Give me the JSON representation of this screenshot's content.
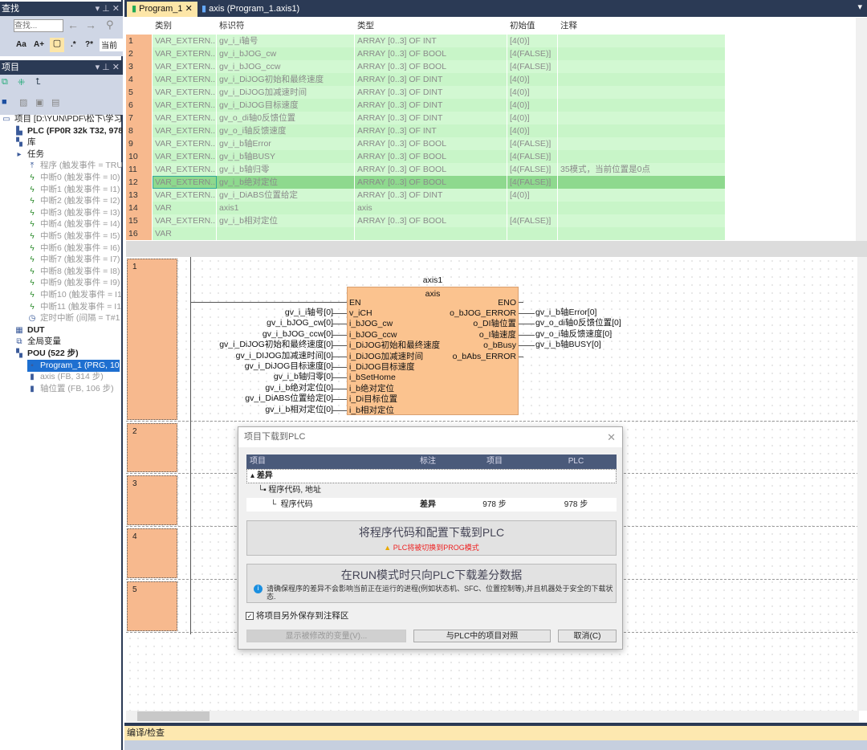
{
  "find_panel": {
    "title": "查找",
    "search_placeholder": "查找...",
    "scope": "当前"
  },
  "project_panel": {
    "title": "项目"
  },
  "tree": [
    {
      "label": "项目 [D:\\YUN\\PDF\\松下\\学习",
      "icon": "project-icon",
      "indent": 0,
      "gray": false,
      "bold": false
    },
    {
      "label": "PLC (FP0R 32k T32, 978",
      "icon": "plc-icon",
      "indent": 1,
      "gray": false,
      "bold": true
    },
    {
      "label": "库",
      "icon": "library-icon",
      "indent": 1,
      "gray": false,
      "bold": false
    },
    {
      "label": "任务",
      "icon": "folder-icon",
      "indent": 1,
      "gray": false,
      "bold": false
    },
    {
      "label": "程序 (触发事件 = TRU",
      "icon": "program-task-icon",
      "indent": 2,
      "gray": true
    },
    {
      "label": "中断0 (触发事件 = I0)",
      "icon": "interrupt-icon",
      "indent": 2,
      "gray": true
    },
    {
      "label": "中断1 (触发事件 = I1)",
      "icon": "interrupt-icon",
      "indent": 2,
      "gray": true
    },
    {
      "label": "中断2 (触发事件 = I2)",
      "icon": "interrupt-icon",
      "indent": 2,
      "gray": true
    },
    {
      "label": "中断3 (触发事件 = I3)",
      "icon": "interrupt-icon",
      "indent": 2,
      "gray": true
    },
    {
      "label": "中断4 (触发事件 = I4)",
      "icon": "interrupt-icon",
      "indent": 2,
      "gray": true
    },
    {
      "label": "中断5 (触发事件 = I5)",
      "icon": "interrupt-icon",
      "indent": 2,
      "gray": true
    },
    {
      "label": "中断6 (触发事件 = I6)",
      "icon": "interrupt-icon",
      "indent": 2,
      "gray": true
    },
    {
      "label": "中断7 (触发事件 = I7)",
      "icon": "interrupt-icon",
      "indent": 2,
      "gray": true
    },
    {
      "label": "中断8 (触发事件 = I8)",
      "icon": "interrupt-icon",
      "indent": 2,
      "gray": true
    },
    {
      "label": "中断9 (触发事件 = I9)",
      "icon": "interrupt-icon",
      "indent": 2,
      "gray": true
    },
    {
      "label": "中断10 (触发事件 = I1",
      "icon": "interrupt-icon",
      "indent": 2,
      "gray": true
    },
    {
      "label": "中断11 (触发事件 = I1",
      "icon": "interrupt-icon",
      "indent": 2,
      "gray": true
    },
    {
      "label": "定时中断 (间隔 = T#1",
      "icon": "timer-icon",
      "indent": 2,
      "gray": true
    },
    {
      "label": "DUT",
      "icon": "dut-icon",
      "indent": 1,
      "bold": true
    },
    {
      "label": "全局变量",
      "icon": "global-vars-icon",
      "indent": 1
    },
    {
      "label": "POU (522 步)",
      "icon": "pou-icon",
      "indent": 1,
      "bold": true
    },
    {
      "label": "Program_1 (PRG, 10",
      "icon": "prg-icon",
      "indent": 2,
      "selected": true
    },
    {
      "label": "axis (FB, 314 步)",
      "icon": "fb-icon",
      "indent": 2,
      "gray": true
    },
    {
      "label": "轴位置 (FB, 106 步)",
      "icon": "fb-icon",
      "indent": 2,
      "gray": true
    }
  ],
  "tabs": [
    {
      "label": "Program_1"
    },
    {
      "label": "axis (Program_1.axis1)"
    }
  ],
  "var_table": {
    "headers": [
      "",
      "类别",
      "标识符",
      "类型",
      "初始值",
      "注释"
    ],
    "rows": [
      [
        "1",
        "VAR_EXTERN...",
        "gv_i_i轴号",
        "ARRAY [0..3] OF  INT",
        "[4(0)]",
        ""
      ],
      [
        "2",
        "VAR_EXTERN...",
        "gv_i_bJOG_cw",
        "ARRAY [0..3] OF BOOL",
        "[4(FALSE)]",
        ""
      ],
      [
        "3",
        "VAR_EXTERN...",
        "gv_i_bJOG_ccw",
        "ARRAY [0..3] OF BOOL",
        "[4(FALSE)]",
        ""
      ],
      [
        "4",
        "VAR_EXTERN...",
        "gv_i_DiJOG初始和最终速度",
        "ARRAY [0..3] OF  DINT",
        "[4(0)]",
        ""
      ],
      [
        "5",
        "VAR_EXTERN...",
        "gv_i_DiJOG加减速时间",
        "ARRAY [0..3] OF  DINT",
        "[4(0)]",
        ""
      ],
      [
        "6",
        "VAR_EXTERN...",
        "gv_i_DiJOG目标速度",
        "ARRAY [0..3] OF DINT",
        "[4(0)]",
        ""
      ],
      [
        "7",
        "VAR_EXTERN...",
        "gv_o_di轴0反馈位置",
        "ARRAY [0..3] OF  DINT",
        "[4(0)]",
        ""
      ],
      [
        "8",
        "VAR_EXTERN...",
        "gv_o_i轴反馈速度",
        "ARRAY [0..3] OF  INT",
        "[4(0)]",
        ""
      ],
      [
        "9",
        "VAR_EXTERN...",
        "gv_i_b轴Error",
        "ARRAY [0..3] OF BOOL",
        "[4(FALSE)]",
        ""
      ],
      [
        "10",
        "VAR_EXTERN...",
        "gv_i_b轴BUSY",
        "ARRAY [0..3] OF BOOL",
        "[4(FALSE)]",
        ""
      ],
      [
        "11",
        "VAR_EXTERN...",
        "gv_i_b轴归零",
        "ARRAY [0..3] OF BOOL",
        "[4(FALSE)]",
        "35模式，当前位置是0点"
      ],
      [
        "12",
        "VAR_EXTERN...",
        "gv_i_b绝对定位",
        "ARRAY [0..3] OF BOOL",
        "[4(FALSE)]",
        ""
      ],
      [
        "13",
        "VAR_EXTERN...",
        "gv_i_DiABS位置给定",
        "ARRAY [0..3] OF DINT",
        "[4(0)]",
        ""
      ],
      [
        "14",
        "VAR",
        "axis1",
        "axis",
        "",
        ""
      ],
      [
        "15",
        "VAR_EXTERN...",
        "gv_i_b相对定位",
        "ARRAY [0..3] OF BOOL",
        "[4(FALSE)]",
        ""
      ],
      [
        "16",
        "VAR",
        "",
        "",
        "",
        ""
      ]
    ],
    "selected_row": 12
  },
  "ladder": {
    "rungs": [
      "1",
      "2",
      "3",
      "4",
      "5"
    ],
    "fb": {
      "instance": "axis1",
      "type": "axis",
      "en": "EN",
      "eno": "ENO",
      "inputs": [
        {
          "pin": "v_iCH",
          "var": "gv_i_i轴号[0]"
        },
        {
          "pin": "i_bJOG_cw",
          "var": "gv_i_bJOG_cw[0]"
        },
        {
          "pin": "i_bJOG_ccw",
          "var": "gv_i_bJOG_ccw[0]"
        },
        {
          "pin": "i_DiJOG初始和最终速度",
          "var": "gv_i_DiJOG初始和最终速度[0]"
        },
        {
          "pin": "i_DiJOG加减速时间",
          "var": "gv_i_DIJOG加减速时间[0]"
        },
        {
          "pin": "i_DiJOG目标速度",
          "var": "gv_i_DiJOG目标速度[0]"
        },
        {
          "pin": "i_bSetHome",
          "var": "gv_i_b轴归零[0]"
        },
        {
          "pin": "i_b绝对定位",
          "var": "gv_i_b绝对定位[0]"
        },
        {
          "pin": "i_Di目标位置",
          "var": "gv_i_DiABS位置给定[0]"
        },
        {
          "pin": "i_b相对定位",
          "var": "gv_i_b相对定位[0]"
        }
      ],
      "outputs": [
        {
          "pin": "o_bJOG_ERROR",
          "var": "gv_i_b轴Error[0]"
        },
        {
          "pin": "o_DI轴位置",
          "var": "gv_o_di轴0反馈位置[0]"
        },
        {
          "pin": "o_I轴速度",
          "var": "gv_o_i轴反馈速度[0]"
        },
        {
          "pin": "o_bBusy",
          "var": "gv_i_b轴BUSY[0]"
        },
        {
          "pin": "o_bAbs_ERROR",
          "var": ""
        }
      ]
    }
  },
  "dialog": {
    "title": "项目下载到PLC",
    "headers": [
      "项目",
      "标注",
      "项目",
      "PLC"
    ],
    "rows": [
      {
        "name": "差异",
        "mark": "",
        "project": "",
        "plc": ""
      },
      {
        "name": "程序代码, 地址",
        "mark": "",
        "project": "",
        "plc": ""
      },
      {
        "name": "程序代码",
        "mark": "差异",
        "project": "978 步",
        "plc": "978 步"
      }
    ],
    "download_all": {
      "title": "将程序代码和配置下载到PLC",
      "warning": "PLC将被切换到PROG模式"
    },
    "download_diff": {
      "title": "在RUN模式时只向PLC下载差分数据",
      "info": "请确保程序的差异不会影响当前正在运行的进程(例如状态机、SFC、位置控制等),并且机器处于安全的下载状态."
    },
    "checkbox": {
      "label": "将项目另外保存到注释区",
      "checked": true
    },
    "buttons": {
      "show_changed": "显示被修改的变量(V)...",
      "compare": "与PLC中的项目对照",
      "cancel": "取消(C)"
    }
  },
  "bottom_panel": {
    "title": "编译/检查"
  }
}
